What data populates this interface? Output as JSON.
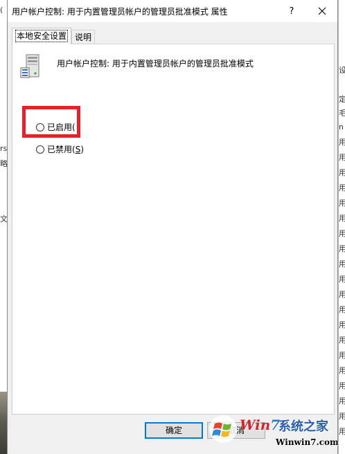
{
  "dialog": {
    "title": "用户帐户控制: 用于内置管理员帐户的管理员批准模式 属性",
    "help_label": "?",
    "close_label": "close"
  },
  "tabs": [
    {
      "label": "本地安全设置",
      "active": true
    },
    {
      "label": "说明",
      "active": false
    }
  ],
  "policy": {
    "name": "用户帐户控制: 用于内置管理员帐户的管理员批准模式",
    "icon": "server-computer-icon"
  },
  "options": {
    "enabled": {
      "label": "已启用(",
      "selected": false
    },
    "disabled": {
      "label_prefix": "已禁用(",
      "accel": "S",
      "label_suffix": ")",
      "selected": false
    }
  },
  "buttons": {
    "ok": "确定",
    "cancel": "取消"
  },
  "highlight_color": "#e8202a",
  "background": {
    "left_fragments": [
      "(",
      "rs",
      "略",
      "文"
    ],
    "right_fragments": [
      "设",
      "定",
      "毛",
      "n",
      "用",
      "用",
      "用",
      "用",
      "用",
      "用",
      "用",
      "用",
      "用",
      "用",
      "用",
      "用",
      "用",
      "用",
      "用",
      "用",
      "用",
      "用",
      "用",
      "用"
    ]
  },
  "watermark": {
    "brand_win": "Win",
    "brand_seven": "7",
    "brand_cn": "系统之家",
    "url": "Winwin7.com"
  }
}
